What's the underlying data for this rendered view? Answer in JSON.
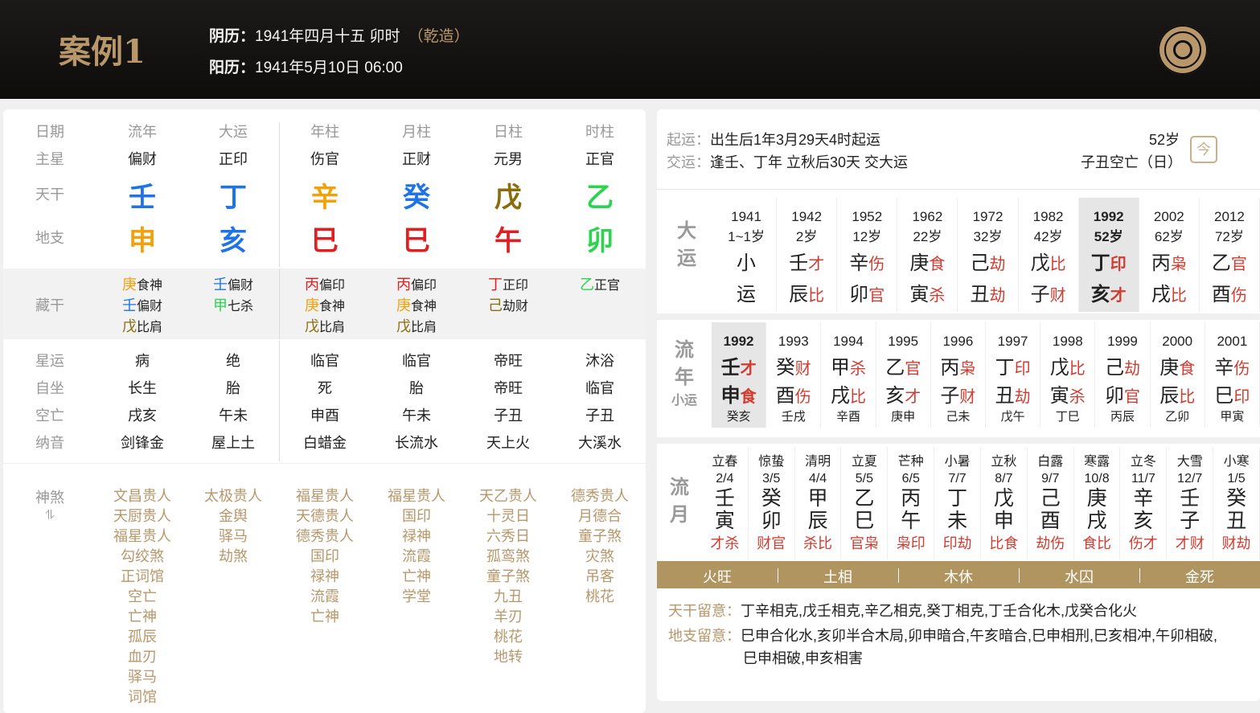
{
  "header": {
    "title": "案例1",
    "lunar_label": "阴历：",
    "lunar_value": "1941年四月十五 卯时",
    "gender": "（乾造）",
    "solar_label": "阳历：",
    "solar_value": "1941年5月10日 06:00"
  },
  "chart": {
    "columns": [
      "日期",
      "流年",
      "大运",
      "年柱",
      "月柱",
      "日柱",
      "时柱"
    ],
    "main_star": {
      "label": "主星",
      "values": [
        "偏财",
        "正印",
        "伤官",
        "正财",
        "元男",
        "正官"
      ]
    },
    "tiangan": {
      "label": "天干",
      "values": [
        "壬",
        "丁",
        "辛",
        "癸",
        "戊",
        "乙"
      ],
      "colors": [
        "#1e73e8",
        "#1e73e8",
        "#f2a10a",
        "#1e73e8",
        "#8a6d0b",
        "#2bd34e"
      ]
    },
    "dizhi": {
      "label": "地支",
      "values": [
        "申",
        "亥",
        "巳",
        "巳",
        "午",
        "卯"
      ],
      "colors": [
        "#f2a10a",
        "#1e73e8",
        "#e02020",
        "#e02020",
        "#e02020",
        "#2bd34e"
      ]
    },
    "canggan": {
      "label": "藏干",
      "cols": [
        [
          {
            "s": "庚",
            "t": "食神",
            "c": "#f2a10a"
          },
          {
            "s": "壬",
            "t": "偏财",
            "c": "#1e73e8"
          },
          {
            "s": "戊",
            "t": "比肩",
            "c": "#8a6d0b"
          }
        ],
        [
          {
            "s": "壬",
            "t": "偏财",
            "c": "#1e73e8"
          },
          {
            "s": "甲",
            "t": "七杀",
            "c": "#2bd34e"
          }
        ],
        [
          {
            "s": "丙",
            "t": "偏印",
            "c": "#e02020"
          },
          {
            "s": "庚",
            "t": "食神",
            "c": "#f2a10a"
          },
          {
            "s": "戊",
            "t": "比肩",
            "c": "#8a6d0b"
          }
        ],
        [
          {
            "s": "丙",
            "t": "偏印",
            "c": "#e02020"
          },
          {
            "s": "庚",
            "t": "食神",
            "c": "#f2a10a"
          },
          {
            "s": "戊",
            "t": "比肩",
            "c": "#8a6d0b"
          }
        ],
        [
          {
            "s": "丁",
            "t": "正印",
            "c": "#e02020"
          },
          {
            "s": "己",
            "t": "劫财",
            "c": "#8a6d0b"
          }
        ],
        [
          {
            "s": "乙",
            "t": "正官",
            "c": "#2bd34e"
          }
        ]
      ]
    },
    "xingyun": {
      "label": "星运",
      "values": [
        "病",
        "绝",
        "临官",
        "临官",
        "帝旺",
        "沐浴"
      ]
    },
    "zizuo": {
      "label": "自坐",
      "values": [
        "长生",
        "胎",
        "死",
        "胎",
        "帝旺",
        "临官"
      ]
    },
    "kongwang": {
      "label": "空亡",
      "values": [
        "戌亥",
        "午未",
        "申酉",
        "午未",
        "子丑",
        "子丑"
      ]
    },
    "nayin": {
      "label": "纳音",
      "values": [
        "剑锋金",
        "屋上土",
        "白蜡金",
        "长流水",
        "天上火",
        "大溪水"
      ]
    },
    "shensha": {
      "label": "神煞",
      "cols": [
        [
          "文昌贵人",
          "天厨贵人",
          "福星贵人",
          "勾绞煞",
          "正词馆",
          "空亡",
          "亡神",
          "孤辰",
          "血刃",
          "驿马",
          "词馆"
        ],
        [
          "太极贵人",
          "金舆",
          "驿马",
          "劫煞"
        ],
        [
          "福星贵人",
          "天德贵人",
          "德秀贵人",
          "国印",
          "禄神",
          "流霞",
          "亡神"
        ],
        [
          "福星贵人",
          "国印",
          "禄神",
          "流霞",
          "亡神",
          "学堂"
        ],
        [
          "天乙贵人",
          "十灵日",
          "六秀日",
          "孤鸾煞",
          "童子煞",
          "九丑",
          "羊刃",
          "桃花",
          "地转"
        ],
        [
          "德秀贵人",
          "月德合",
          "童子煞",
          "灾煞",
          "吊客",
          "桃花"
        ]
      ]
    }
  },
  "qiyun": {
    "label1": "起运：",
    "value1": "出生后1年3月29天4时起运",
    "label2": "交运：",
    "value2": "逢壬、丁年 立秋后30天 交大运",
    "age": "52岁",
    "kongwang": "子丑空亡（日）",
    "today_label": "今"
  },
  "dayun": {
    "label": [
      "大",
      "运"
    ],
    "items": [
      {
        "y": "1941",
        "a": "1~1岁",
        "g": "小",
        "gs": "",
        "z": "运",
        "zs": ""
      },
      {
        "y": "1942",
        "a": "2岁",
        "g": "壬",
        "gs": "才",
        "z": "辰",
        "zs": "比"
      },
      {
        "y": "1952",
        "a": "12岁",
        "g": "辛",
        "gs": "伤",
        "z": "卯",
        "zs": "官"
      },
      {
        "y": "1962",
        "a": "22岁",
        "g": "庚",
        "gs": "食",
        "z": "寅",
        "zs": "杀"
      },
      {
        "y": "1972",
        "a": "32岁",
        "g": "己",
        "gs": "劫",
        "z": "丑",
        "zs": "劫"
      },
      {
        "y": "1982",
        "a": "42岁",
        "g": "戊",
        "gs": "比",
        "z": "子",
        "zs": "财"
      },
      {
        "y": "1992",
        "a": "52岁",
        "g": "丁",
        "gs": "印",
        "z": "亥",
        "zs": "才"
      },
      {
        "y": "2002",
        "a": "62岁",
        "g": "丙",
        "gs": "枭",
        "z": "戌",
        "zs": "比"
      },
      {
        "y": "2012",
        "a": "72岁",
        "g": "乙",
        "gs": "官",
        "z": "酉",
        "zs": "伤"
      }
    ],
    "selected": 6
  },
  "liunian": {
    "label": [
      "流",
      "年"
    ],
    "sub": "小运",
    "items": [
      {
        "y": "1992",
        "g": "壬",
        "gs": "才",
        "z": "申",
        "zs": "食",
        "x": "癸亥"
      },
      {
        "y": "1993",
        "g": "癸",
        "gs": "财",
        "z": "酉",
        "zs": "伤",
        "x": "壬戌"
      },
      {
        "y": "1994",
        "g": "甲",
        "gs": "杀",
        "z": "戌",
        "zs": "比",
        "x": "辛酉"
      },
      {
        "y": "1995",
        "g": "乙",
        "gs": "官",
        "z": "亥",
        "zs": "才",
        "x": "庚申"
      },
      {
        "y": "1996",
        "g": "丙",
        "gs": "枭",
        "z": "子",
        "zs": "财",
        "x": "己未"
      },
      {
        "y": "1997",
        "g": "丁",
        "gs": "印",
        "z": "丑",
        "zs": "劫",
        "x": "戊午"
      },
      {
        "y": "1998",
        "g": "戊",
        "gs": "比",
        "z": "寅",
        "zs": "杀",
        "x": "丁巳"
      },
      {
        "y": "1999",
        "g": "己",
        "gs": "劫",
        "z": "卯",
        "zs": "官",
        "x": "丙辰"
      },
      {
        "y": "2000",
        "g": "庚",
        "gs": "食",
        "z": "辰",
        "zs": "比",
        "x": "乙卯"
      },
      {
        "y": "2001",
        "g": "辛",
        "gs": "伤",
        "z": "巳",
        "zs": "印",
        "x": "甲寅"
      }
    ],
    "selected": 0
  },
  "liuyue": {
    "label": [
      "流",
      "月"
    ],
    "items": [
      {
        "j": "立春",
        "d": "2/4",
        "g": "壬",
        "z": "寅",
        "s": "才杀"
      },
      {
        "j": "惊蛰",
        "d": "3/5",
        "g": "癸",
        "z": "卯",
        "s": "财官"
      },
      {
        "j": "清明",
        "d": "4/4",
        "g": "甲",
        "z": "辰",
        "s": "杀比"
      },
      {
        "j": "立夏",
        "d": "5/5",
        "g": "乙",
        "z": "巳",
        "s": "官枭"
      },
      {
        "j": "芒种",
        "d": "6/5",
        "g": "丙",
        "z": "午",
        "s": "枭印"
      },
      {
        "j": "小暑",
        "d": "7/7",
        "g": "丁",
        "z": "未",
        "s": "印劫"
      },
      {
        "j": "立秋",
        "d": "8/7",
        "g": "戊",
        "z": "申",
        "s": "比食"
      },
      {
        "j": "白露",
        "d": "9/7",
        "g": "己",
        "z": "酉",
        "s": "劫伤"
      },
      {
        "j": "寒露",
        "d": "10/8",
        "g": "庚",
        "z": "戌",
        "s": "食比"
      },
      {
        "j": "立冬",
        "d": "11/7",
        "g": "辛",
        "z": "亥",
        "s": "伤才"
      },
      {
        "j": "大雪",
        "d": "12/7",
        "g": "壬",
        "z": "子",
        "s": "才财"
      },
      {
        "j": "小寒",
        "d": "1/5",
        "g": "癸",
        "z": "丑",
        "s": "财劫"
      }
    ]
  },
  "wuxing": [
    "火旺",
    "土相",
    "木休",
    "水囚",
    "金死"
  ],
  "notes": {
    "tg_label": "天干留意：",
    "tg_value": "丁辛相克,戊壬相克,辛乙相克,癸丁相克,丁壬合化木,戊癸合化火",
    "dz_label": "地支留意：",
    "dz_value1": "巳申合化水,亥卯半合木局,卯申暗合,午亥暗合,巳申相刑,巳亥相冲,午卯相破,",
    "dz_value2": "巳申相破,申亥相害"
  }
}
